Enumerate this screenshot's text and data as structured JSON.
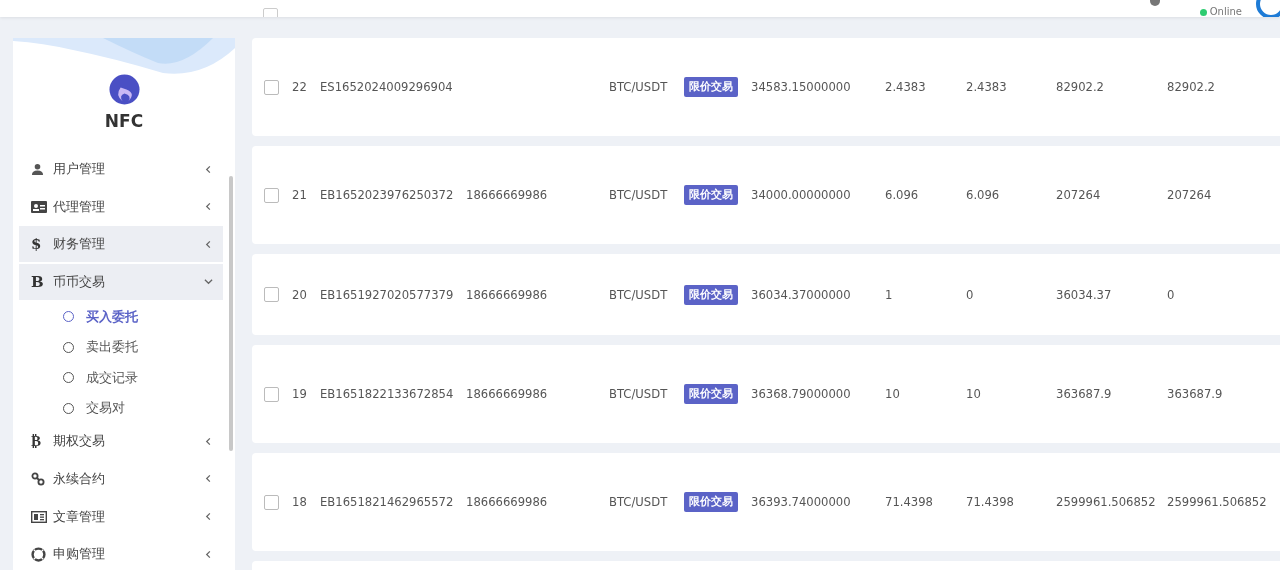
{
  "header": {
    "status": "Online"
  },
  "select_all": {
    "checked": false
  },
  "sidebar": {
    "brand": "NFC",
    "items": [
      {
        "label": "用户管理",
        "selected": false,
        "expanded": false
      },
      {
        "label": "代理管理",
        "selected": false,
        "expanded": false
      },
      {
        "label": "财务管理",
        "glyph": "$",
        "selected": true,
        "expanded": false
      },
      {
        "label": "币币交易",
        "glyph": "B",
        "selected": true,
        "expanded": true,
        "children": [
          {
            "label": "买入委托",
            "selected": true
          },
          {
            "label": "卖出委托",
            "selected": false
          },
          {
            "label": "成交记录",
            "selected": false
          },
          {
            "label": "交易对",
            "selected": false
          }
        ]
      },
      {
        "label": "期权交易",
        "glyph": "₿",
        "selected": false,
        "expanded": false
      },
      {
        "label": "永续合约",
        "selected": false,
        "expanded": false
      },
      {
        "label": "文章管理",
        "selected": false,
        "expanded": false
      },
      {
        "label": "申购管理",
        "selected": false,
        "expanded": false
      }
    ]
  },
  "table": {
    "rows": [
      {
        "checked": false,
        "id": "22",
        "order_no": "ES1652024009296904",
        "phone": "",
        "pair": "BTC/USDT",
        "type": "限价交易",
        "price": "34583.15000000",
        "amount": "2.4383",
        "column_9": "2.4383",
        "total": "82902.2",
        "column_11": "82902.2"
      },
      {
        "checked": false,
        "id": "21",
        "order_no": "EB1652023976250372",
        "phone": "18666669986",
        "pair": "BTC/USDT",
        "type": "限价交易",
        "price": "34000.00000000",
        "amount": "6.096",
        "column_9": "6.096",
        "total": "207264",
        "column_11": "207264"
      },
      {
        "checked": false,
        "id": "20",
        "order_no": "EB1651927020577379",
        "phone": "18666669986",
        "pair": "BTC/USDT",
        "type": "限价交易",
        "price": "36034.37000000",
        "amount": "1",
        "column_9": "0",
        "total": "36034.37",
        "column_11": "0"
      },
      {
        "checked": false,
        "id": "19",
        "order_no": "EB1651822133672854",
        "phone": "18666669986",
        "pair": "BTC/USDT",
        "type": "限价交易",
        "price": "36368.79000000",
        "amount": "10",
        "column_9": "10",
        "total": "363687.9",
        "column_11": "363687.9"
      },
      {
        "checked": false,
        "id": "18",
        "order_no": "EB1651821462965572",
        "phone": "18666669986",
        "pair": "BTC/USDT",
        "type": "限价交易",
        "price": "36393.74000000",
        "amount": "71.4398",
        "column_9": "71.4398",
        "total": "2599961.506852",
        "column_11": "2599961.506852"
      }
    ]
  }
}
